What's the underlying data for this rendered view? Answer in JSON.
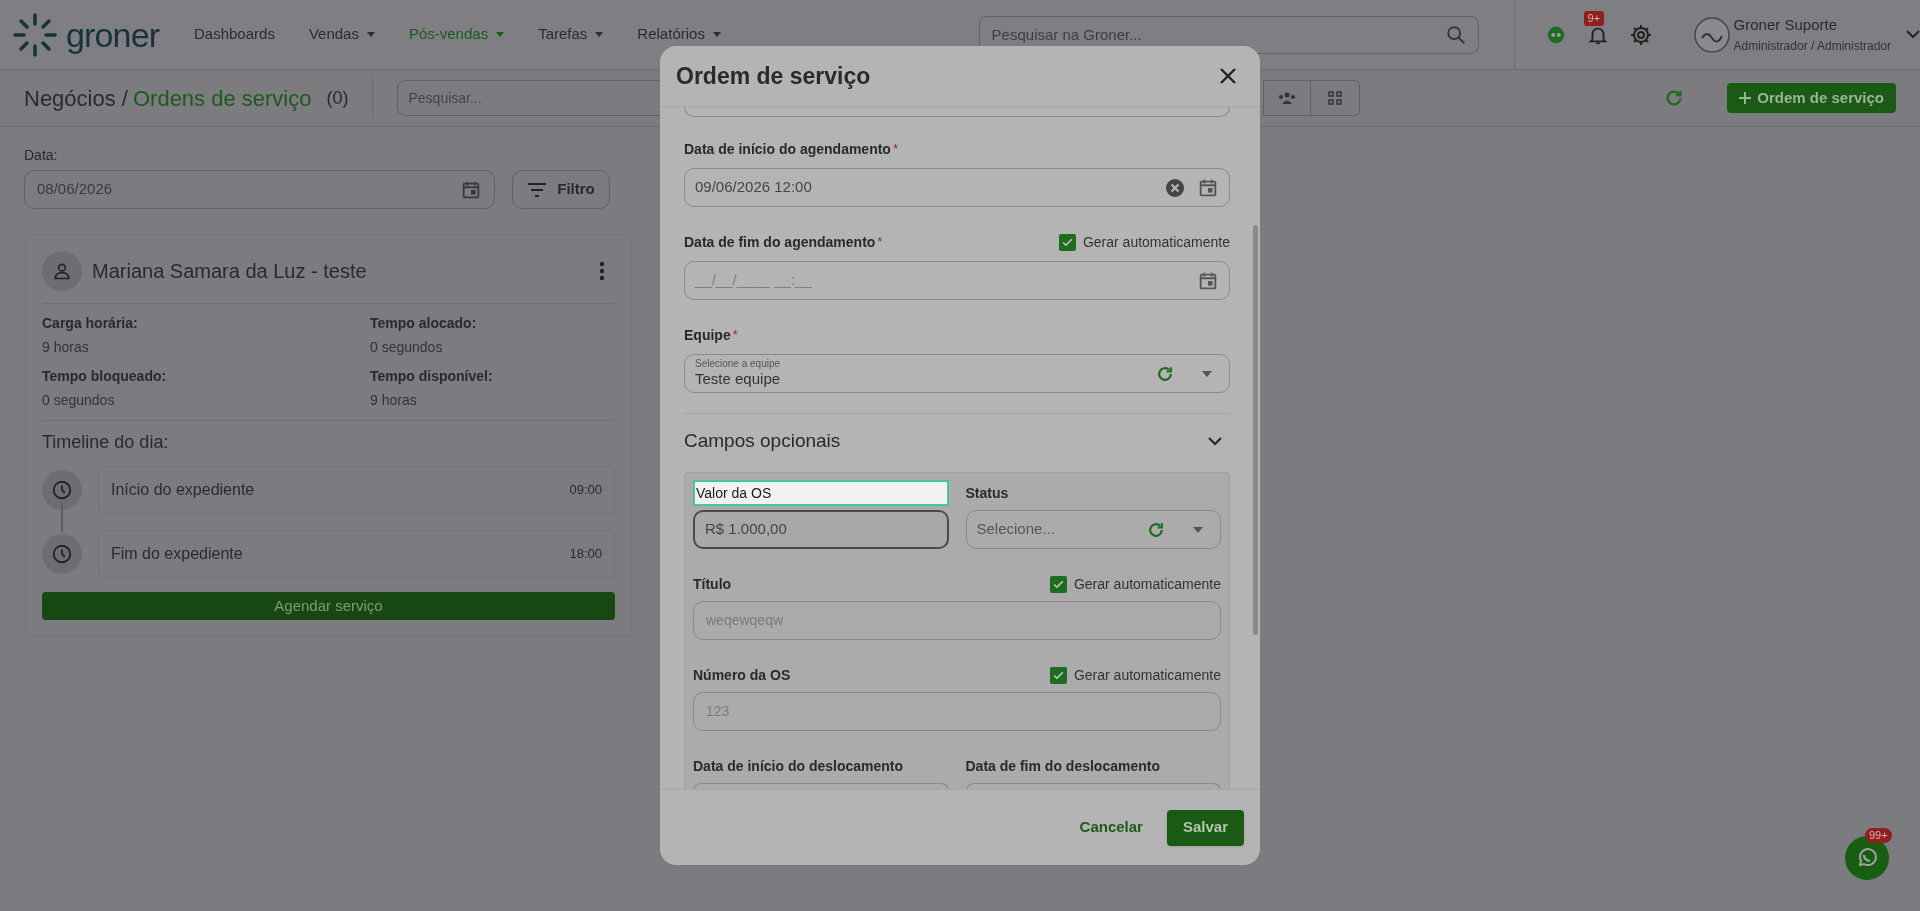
{
  "header": {
    "logo": "groner",
    "nav": [
      {
        "label": "Dashboards",
        "selected": false,
        "dropdown": false
      },
      {
        "label": "Vendas",
        "selected": false,
        "dropdown": true
      },
      {
        "label": "Pós-vendas",
        "selected": true,
        "dropdown": true
      },
      {
        "label": "Tarefas",
        "selected": false,
        "dropdown": true
      },
      {
        "label": "Relatórios",
        "selected": false,
        "dropdown": true
      }
    ],
    "search": {
      "placeholder": "Pesquisar na Groner..."
    },
    "notifications_badge": "9+",
    "user": {
      "name": "Groner Suporte",
      "role": "Administrador / Administrador"
    }
  },
  "toolbar": {
    "breadcrumb": "Negócios /",
    "title": "Ordens de serviço",
    "count": "(0)",
    "search": {
      "placeholder": "Pesquisar..."
    },
    "new_button": "Ordem de serviço"
  },
  "filters": {
    "date_label": "Data:",
    "date_value": "08/06/2026",
    "filter_button": "Filtro"
  },
  "agenda_card": {
    "name": "Mariana Samara da Luz - teste",
    "stats": [
      {
        "label": "Carga horária:",
        "value": "9 horas"
      },
      {
        "label": "Tempo alocado:",
        "value": "0 segundos"
      },
      {
        "label": "Tempo bloqueado:",
        "value": "0 segundos"
      },
      {
        "label": "Tempo disponível:",
        "value": "9 horas"
      }
    ],
    "timeline_title": "Timeline do dia:",
    "timeline": [
      {
        "label": "Início do expediente",
        "time": "09:00"
      },
      {
        "label": "Fim do expediente",
        "time": "18:00"
      }
    ],
    "schedule_button": "Agendar serviço"
  },
  "modal": {
    "title": "Ordem de serviço",
    "fields": [
      {
        "kind": "datetime",
        "label": "Data de início do agendamento",
        "required_mark": "*",
        "value": "09/06/2026 12:00",
        "clearable": true
      },
      {
        "kind": "datetime",
        "label": "Data de fim do agendamento",
        "required_mark": "*",
        "placeholder": "__/__/____ __:__",
        "auto_generate": {
          "label": "Gerar automaticamente",
          "checked": true
        }
      },
      {
        "kind": "select",
        "label": "Equipe",
        "required_mark": "*",
        "floating_label": "Selecione a equipe",
        "value": "Teste equipe"
      }
    ],
    "optional_section": {
      "title": "Campos opcionais",
      "expanded": true,
      "fields": [
        {
          "kind": "currency",
          "label": "Valor da OS",
          "highlighted": true,
          "value": "R$ 1.000,00"
        },
        {
          "kind": "select",
          "label": "Status",
          "highlighted": false,
          "placeholder": "Selecione..."
        },
        {
          "kind": "text",
          "label": "Título",
          "highlighted": false,
          "placeholder": "weqewqeqw",
          "auto_generate": {
            "label": "Gerar automaticamente",
            "checked": true
          }
        },
        {
          "kind": "text",
          "label": "Número da OS",
          "highlighted": false,
          "placeholder": "123",
          "auto_generate": {
            "label": "Gerar automaticamente",
            "checked": true
          }
        },
        {
          "kind": "datetime",
          "label": "Data de início do deslocamento",
          "highlighted": false
        },
        {
          "kind": "datetime",
          "label": "Data de fim do deslocamento",
          "highlighted": false
        }
      ]
    },
    "buttons": [
      {
        "label": "Cancelar",
        "kind": "text"
      },
      {
        "label": "Salvar",
        "kind": "primary"
      }
    ]
  },
  "chat_badge": "99+"
}
